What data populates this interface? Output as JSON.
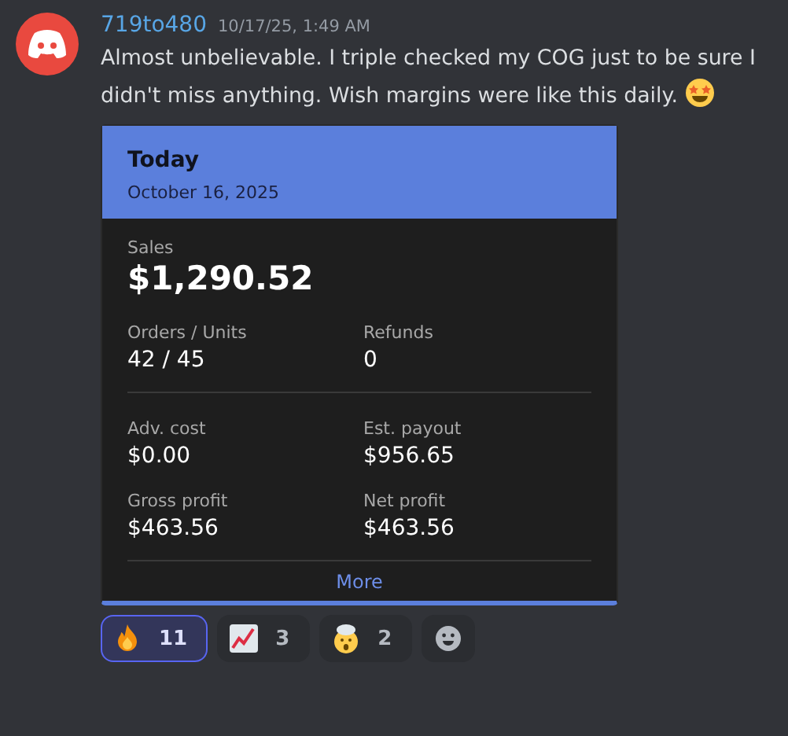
{
  "message": {
    "author": "719to480",
    "timestamp": "10/17/25, 1:49 AM",
    "text": "Almost unbelievable. I triple checked my COG just to be sure I didn't miss anything. Wish margins were like this daily."
  },
  "card": {
    "title": "Today",
    "date": "October 16, 2025",
    "sales_label": "Sales",
    "sales_value": "$1,290.52",
    "sections": [
      {
        "rows": [
          [
            {
              "label": "Orders / Units",
              "value": "42 / 45"
            },
            {
              "label": "Refunds",
              "value": "0"
            }
          ]
        ]
      },
      {
        "rows": [
          [
            {
              "label": "Adv. cost",
              "value": "$0.00"
            },
            {
              "label": "Est. payout",
              "value": "$956.65"
            }
          ],
          [
            {
              "label": "Gross profit",
              "value": "$463.56"
            },
            {
              "label": "Net profit",
              "value": "$463.56"
            }
          ]
        ]
      }
    ],
    "more": "More"
  },
  "reactions": [
    {
      "kind": "fire",
      "count": "11",
      "selected": true
    },
    {
      "kind": "chart",
      "count": "3",
      "selected": false
    },
    {
      "kind": "exploding",
      "count": "2",
      "selected": false
    }
  ]
}
